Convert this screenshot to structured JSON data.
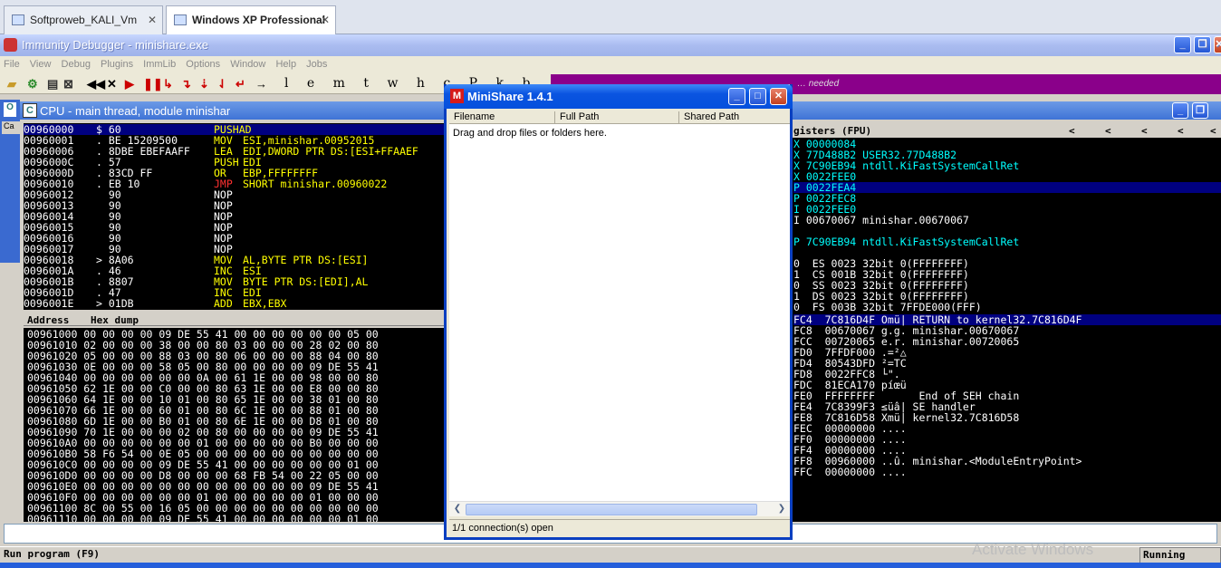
{
  "vm_tabs": [
    "Softproweb_KALI_Vm",
    "Windows XP Professional"
  ],
  "app_title": "Immunity Debugger - minishare.exe",
  "menu": [
    "File",
    "View",
    "Debug",
    "Plugins",
    "ImmLib",
    "Options",
    "Window",
    "Help",
    "Jobs"
  ],
  "toolbar_letters": "l e m t w h c P k b",
  "purple_text": "… needed",
  "cpu_title": "CPU - main thread, module minishar",
  "cpu_rows": [
    {
      "addr": "00960000",
      "hex": "$ 60",
      "asm": "PUSHAD",
      "arg": "",
      "color": "y",
      "sel": true
    },
    {
      "addr": "00960001",
      "hex": ". BE 15209500",
      "asm": "MOV",
      "arg": "ESI,minishar.00952015",
      "color": "y"
    },
    {
      "addr": "00960006",
      "hex": ". 8DBE EBEFAAFF",
      "asm": "LEA",
      "arg": "EDI,DWORD PTR DS:[ESI+FFAAEF",
      "color": "y"
    },
    {
      "addr": "0096000C",
      "hex": ". 57",
      "asm": "PUSH",
      "arg": "EDI",
      "color": "y"
    },
    {
      "addr": "0096000D",
      "hex": ". 83CD FF",
      "asm": "OR",
      "arg": "EBP,FFFFFFFF",
      "color": "y"
    },
    {
      "addr": "00960010",
      "hex": ". EB 10",
      "asm": "JMP",
      "arg": "SHORT minishar.00960022",
      "color": "r"
    },
    {
      "addr": "00960012",
      "hex": "  90",
      "asm": "NOP",
      "arg": "",
      "color": "w"
    },
    {
      "addr": "00960013",
      "hex": "  90",
      "asm": "NOP",
      "arg": "",
      "color": "w"
    },
    {
      "addr": "00960014",
      "hex": "  90",
      "asm": "NOP",
      "arg": "",
      "color": "w"
    },
    {
      "addr": "00960015",
      "hex": "  90",
      "asm": "NOP",
      "arg": "",
      "color": "w"
    },
    {
      "addr": "00960016",
      "hex": "  90",
      "asm": "NOP",
      "arg": "",
      "color": "w"
    },
    {
      "addr": "00960017",
      "hex": "  90",
      "asm": "NOP",
      "arg": "",
      "color": "w"
    },
    {
      "addr": "00960018",
      "hex": "> 8A06",
      "asm": "MOV",
      "arg": "AL,BYTE PTR DS:[ESI]",
      "color": "y"
    },
    {
      "addr": "0096001A",
      "hex": ". 46",
      "asm": "INC",
      "arg": "ESI",
      "color": "y"
    },
    {
      "addr": "0096001B",
      "hex": ". 8807",
      "asm": "MOV",
      "arg": "BYTE PTR DS:[EDI],AL",
      "color": "y"
    },
    {
      "addr": "0096001D",
      "hex": ". 47",
      "asm": "INC",
      "arg": "EDI",
      "color": "y"
    },
    {
      "addr": "0096001E",
      "hex": "> 01DB",
      "asm": "ADD",
      "arg": "EBX,EBX",
      "color": "y"
    }
  ],
  "dump_header": {
    "address": "Address",
    "hex": "Hex dump"
  },
  "dump_rows": [
    "00961000 00 00 00 00 09 DE 55 41 00 00 00 00 00 00 05 00",
    "00961010 02 00 00 00 38 00 00 80 03 00 00 00 28 02 00 80",
    "00961020 05 00 00 00 88 03 00 80 06 00 00 00 88 04 00 80",
    "00961030 0E 00 00 00 58 05 00 80 00 00 00 00 09 DE 55 41",
    "00961040 00 00 00 00 00 00 0A 00 61 1E 00 00 98 00 00 80",
    "00961050 62 1E 00 00 C0 00 00 80 63 1E 00 00 E8 00 00 80",
    "00961060 64 1E 00 00 10 01 00 80 65 1E 00 00 38 01 00 80",
    "00961070 66 1E 00 00 60 01 00 80 6C 1E 00 00 88 01 00 80",
    "00961080 6D 1E 00 00 B0 01 00 80 6E 1E 00 00 D8 01 00 80",
    "00961090 70 1E 00 00 00 02 00 80 00 00 00 00 09 DE 55 41",
    "009610A0 00 00 00 00 00 00 01 00 00 00 00 00 B0 00 00 00",
    "009610B0 58 F6 54 00 0E 05 00 00 00 00 00 00 00 00 00 00",
    "009610C0 00 00 00 00 09 DE 55 41 00 00 00 00 00 00 01 00",
    "009610D0 00 00 00 00 D8 00 00 00 68 FB 54 00 22 05 00 00",
    "009610E0 00 00 00 00 00 00 00 00 00 00 00 00 09 DE 55 41",
    "009610F0 00 00 00 00 00 00 01 00 00 00 00 00 01 00 00 00",
    "00961100 8C 00 55 00 16 05 00 00 00 00 00 00 00 00 00 00",
    "00961110 00 00 00 00 09 DE 55 41 00 00 00 00 00 00 01 00"
  ],
  "reg_header": "gisters (FPU)",
  "reg_rows": [
    {
      "t": "X 00000084",
      "c": "c"
    },
    {
      "t": "X 77D488B2 USER32.77D488B2",
      "c": "c"
    },
    {
      "t": "X 7C90EB94 ntdll.KiFastSystemCallRet",
      "c": "c"
    },
    {
      "t": "X 0022FEE0",
      "c": "c"
    },
    {
      "t": "P 0022FEA4",
      "c": "c",
      "hl": true
    },
    {
      "t": "P 0022FEC8",
      "c": "c"
    },
    {
      "t": "I 0022FEE0",
      "c": "c"
    },
    {
      "t": "I 00670067 minishar.00670067",
      "c": "w"
    },
    {
      "t": "",
      "c": "w"
    },
    {
      "t": "P 7C90EB94 ntdll.KiFastSystemCallRet",
      "c": "c"
    },
    {
      "t": "",
      "c": "w"
    },
    {
      "t": "0  ES 0023 32bit 0(FFFFFFFF)",
      "c": "w"
    },
    {
      "t": "1  CS 001B 32bit 0(FFFFFFFF)",
      "c": "w"
    },
    {
      "t": "0  SS 0023 32bit 0(FFFFFFFF)",
      "c": "w"
    },
    {
      "t": "1  DS 0023 32bit 0(FFFFFFFF)",
      "c": "w"
    },
    {
      "t": "0  FS 003B 32bit 7FFDE000(FFF)",
      "c": "w"
    },
    {
      "t": "0  GS 0000 NULL",
      "c": "w"
    }
  ],
  "stack_rows": [
    {
      "t": "FC4  7C816D4F Omü| RETURN to kernel32.7C816D4F",
      "sel": true
    },
    {
      "t": "FC8  00670067 g.g. minishar.00670067"
    },
    {
      "t": "FCC  00720065 e.r. minishar.00720065"
    },
    {
      "t": "FD0  7FFDF000 .=²△"
    },
    {
      "t": "FD4  80543DFD ²=TC"
    },
    {
      "t": "FD8  0022FFC8 └\"."
    },
    {
      "t": "FDC  81ECA170 píœü"
    },
    {
      "t": "FE0  FFFFFFFF       End of SEH chain"
    },
    {
      "t": "FE4  7C8399F3 ≤üâ| SE handler"
    },
    {
      "t": "FE8  7C816D58 Xmü| kernel32.7C816D58"
    },
    {
      "t": "FEC  00000000 ...."
    },
    {
      "t": "FF0  00000000 ...."
    },
    {
      "t": "FF4  00000000 ...."
    },
    {
      "t": "FF8  00960000 ..û. minishar.<ModuleEntryPoint>"
    },
    {
      "t": "FFC  00000000 ...."
    }
  ],
  "minishare": {
    "title": "MiniShare 1.4.1",
    "columns": [
      "Filename",
      "Full Path",
      "Shared Path"
    ],
    "placeholder": "Drag and drop files or folders here.",
    "status": "1/1 connection(s) open"
  },
  "status_left": "Run program (F9)",
  "status_right": "Running",
  "watermark": "Activate Windows"
}
